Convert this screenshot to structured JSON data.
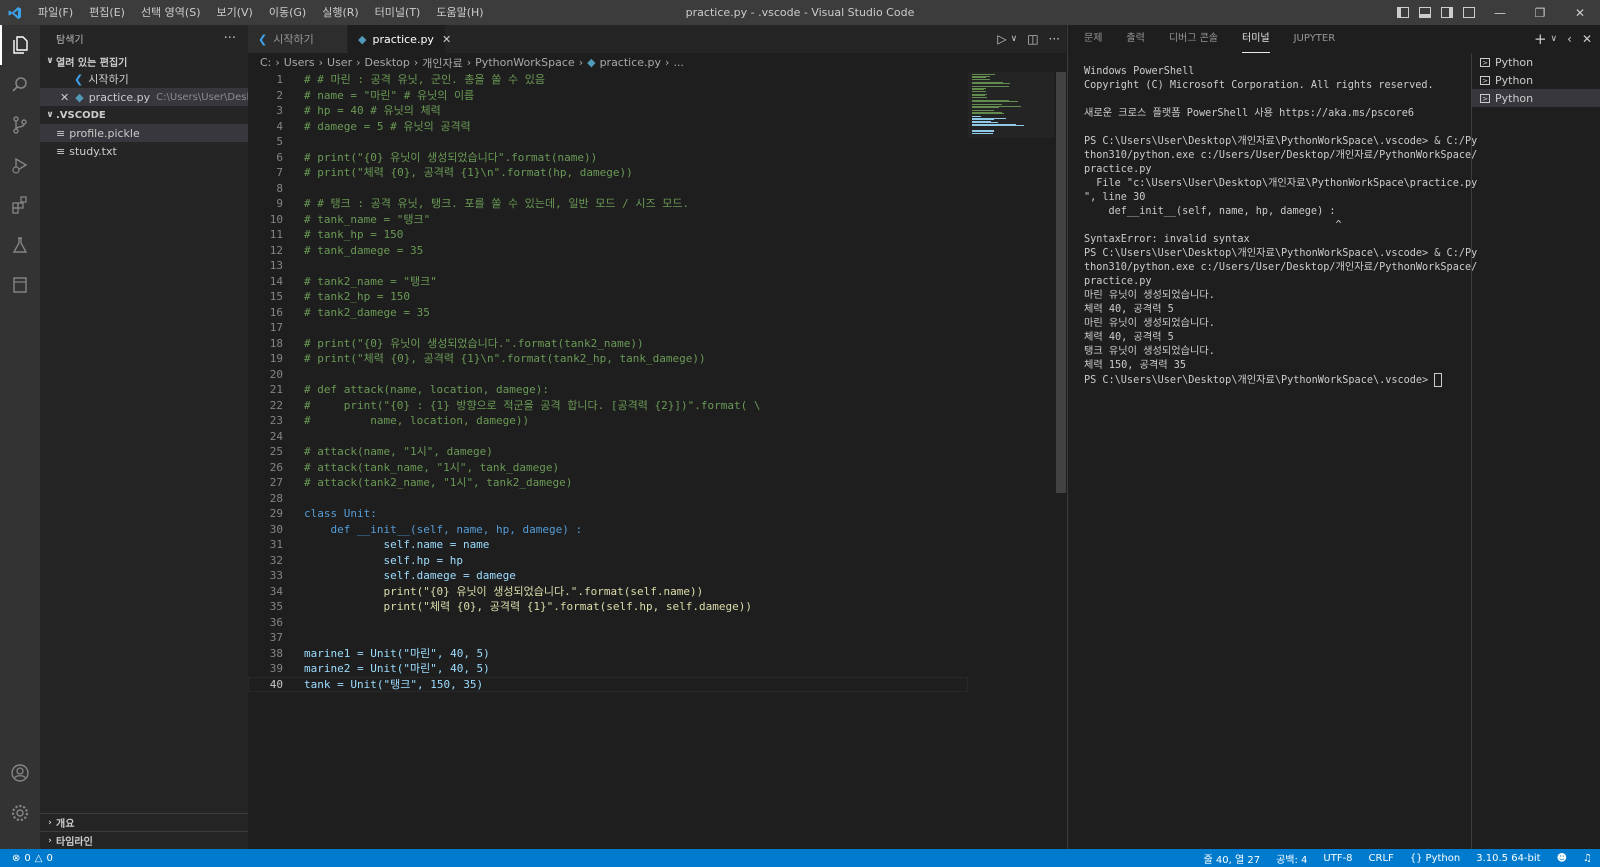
{
  "window": {
    "title": "practice.py - .vscode - Visual Studio Code"
  },
  "menu": [
    "파일(F)",
    "편집(E)",
    "선택 영역(S)",
    "보기(V)",
    "이동(G)",
    "실행(R)",
    "터미널(T)",
    "도움말(H)"
  ],
  "sidebar": {
    "title": "탐색기",
    "open_editors_label": "열려 있는 편집기",
    "open_editors": [
      {
        "name": "시작하기",
        "path": ""
      },
      {
        "name": "practice.py",
        "path": "C:\\Users\\User\\Deskto..."
      }
    ],
    "folder_label": ".VSCODE",
    "files": [
      "profile.pickle",
      "study.txt"
    ],
    "outline_label": "개요",
    "timeline_label": "타임라인"
  },
  "tabs": [
    {
      "label": "시작하기"
    },
    {
      "label": "practice.py"
    }
  ],
  "breadcrumb": [
    "C:",
    "Users",
    "User",
    "Desktop",
    "개인자료",
    "PythonWorkSpace",
    "practice.py",
    "..."
  ],
  "code_lines": [
    "# # 마린 : 공격 유닛, 군인. 총을 쏠 수 있음",
    "# name = \"마린\" # 유닛의 이름",
    "# hp = 40 # 유닛의 체력",
    "# damege = 5 # 유닛의 공격력",
    "",
    "# print(\"{0} 유닛이 생성되었습니다\".format(name))",
    "# print(\"체력 {0}, 공격력 {1}\\n\".format(hp, damege))",
    "",
    "# # 탱크 : 공격 유닛, 탱크. 포를 쏠 수 있는데, 일반 모드 / 시즈 모드.",
    "# tank_name = \"탱크\"",
    "# tank_hp = 150",
    "# tank_damege = 35",
    "",
    "# tank2_name = \"탱크\"",
    "# tank2_hp = 150",
    "# tank2_damege = 35",
    "",
    "# print(\"{0} 유닛이 생성되었습니다.\".format(tank2_name))",
    "# print(\"체력 {0}, 공격력 {1}\\n\".format(tank2_hp, tank_damege))",
    "",
    "# def attack(name, location, damege):",
    "#     print(\"{0} : {1} 방향으로 적군을 공격 합니다. [공격력 {2}])\".format( \\",
    "#         name, location, damege))",
    "",
    "# attack(name, \"1시\", damege)",
    "# attack(tank_name, \"1시\", tank_damege)",
    "# attack(tank2_name, \"1시\", tank2_damege)",
    "",
    "class Unit:",
    "    def __init__(self, name, hp, damege) :",
    "            self.name = name",
    "            self.hp = hp",
    "            self.damege = damege",
    "            print(\"{0} 유닛이 생성되었습니다.\".format(self.name))",
    "            print(\"체력 {0}, 공격력 {1}\".format(self.hp, self.damege))",
    "",
    "",
    "marine1 = Unit(\"마린\", 40, 5)",
    "marine2 = Unit(\"마린\", 40, 5)",
    "tank = Unit(\"탱크\", 150, 35)"
  ],
  "current_line": 40,
  "panel": {
    "tabs": [
      "문제",
      "출력",
      "디버그 콘솔",
      "터미널",
      "JUPYTER"
    ],
    "active_tab": "터미널",
    "terminals": [
      "Python",
      "Python",
      "Python"
    ],
    "terminal_lines": [
      "Windows PowerShell",
      "Copyright (C) Microsoft Corporation. All rights reserved.",
      "",
      "새로운 크로스 플랫폼 PowerShell 사용 https://aka.ms/pscore6",
      "",
      "PS C:\\Users\\User\\Desktop\\개인자료\\PythonWorkSpace\\.vscode> & C:/Py",
      "thon310/python.exe c:/Users/User/Desktop/개인자료/PythonWorkSpace/",
      "practice.py",
      "  File \"c:\\Users\\User\\Desktop\\개인자료\\PythonWorkSpace\\practice.py",
      "\", line 30",
      "    def__init__(self, name, hp, damege) :",
      "                                         ^",
      "SyntaxError: invalid syntax",
      "PS C:\\Users\\User\\Desktop\\개인자료\\PythonWorkSpace\\.vscode> & C:/Py",
      "thon310/python.exe c:/Users/User/Desktop/개인자료/PythonWorkSpace/",
      "practice.py",
      "마린 유닛이 생성되었습니다.",
      "체력 40, 공격력 5",
      "마린 유닛이 생성되었습니다.",
      "체력 40, 공격력 5",
      "탱크 유닛이 생성되었습니다.",
      "체력 150, 공격력 35",
      "PS C:\\Users\\User\\Desktop\\개인자료\\PythonWorkSpace\\.vscode> "
    ]
  },
  "status": {
    "errors": "0",
    "warnings": "0",
    "position": "줄 40, 열 27",
    "spaces": "공백: 4",
    "encoding": "UTF-8",
    "eol": "CRLF",
    "language": "Python",
    "interpreter": "3.10.5 64-bit"
  },
  "colors": {
    "accent": "#007acc",
    "titlebar": "#3c3c3c",
    "activitybar": "#333333",
    "sidebar": "#252526",
    "editor": "#1e1e1e"
  }
}
